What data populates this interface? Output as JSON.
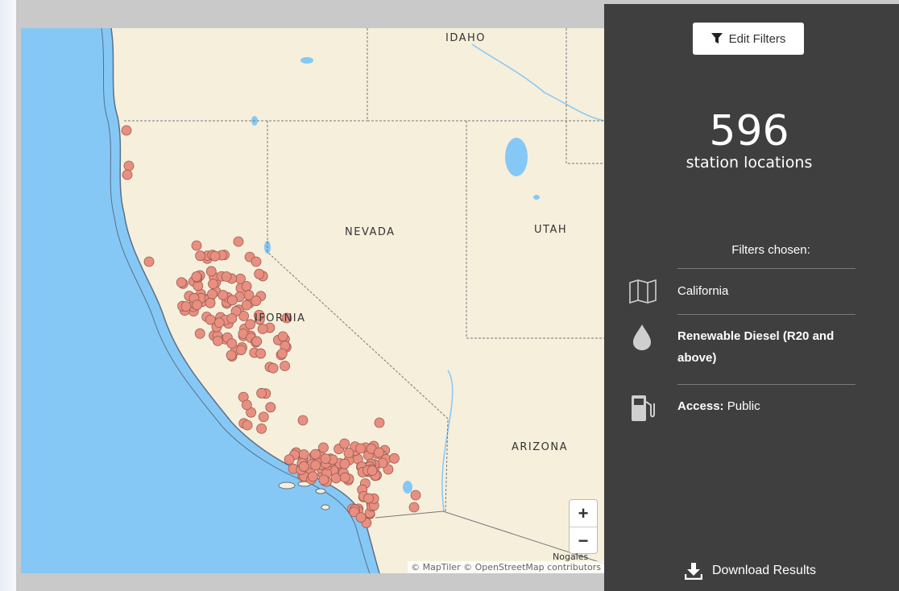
{
  "map": {
    "labels": {
      "idaho": "IDAHO",
      "nevada": "NEVADA",
      "utah": "UTAH",
      "california": "IFORNIA",
      "arizona": "ARIZONA",
      "nogales": "Nogales"
    },
    "zoom_in": "+",
    "zoom_out": "−",
    "attribution": "© MapTiler © OpenStreetMap contributors",
    "marker_color": "#e88f80",
    "water_color": "#86c8f5",
    "land_color": "#f6efdc"
  },
  "panel": {
    "edit_filters": "Edit Filters",
    "count": "596",
    "count_label": "station locations",
    "filters_heading": "Filters chosen:",
    "filters": {
      "state": "California",
      "fuel": "Renewable Diesel (R20 and above)",
      "access_label": "Access:",
      "access_value": "Public"
    },
    "download": "Download Results"
  }
}
